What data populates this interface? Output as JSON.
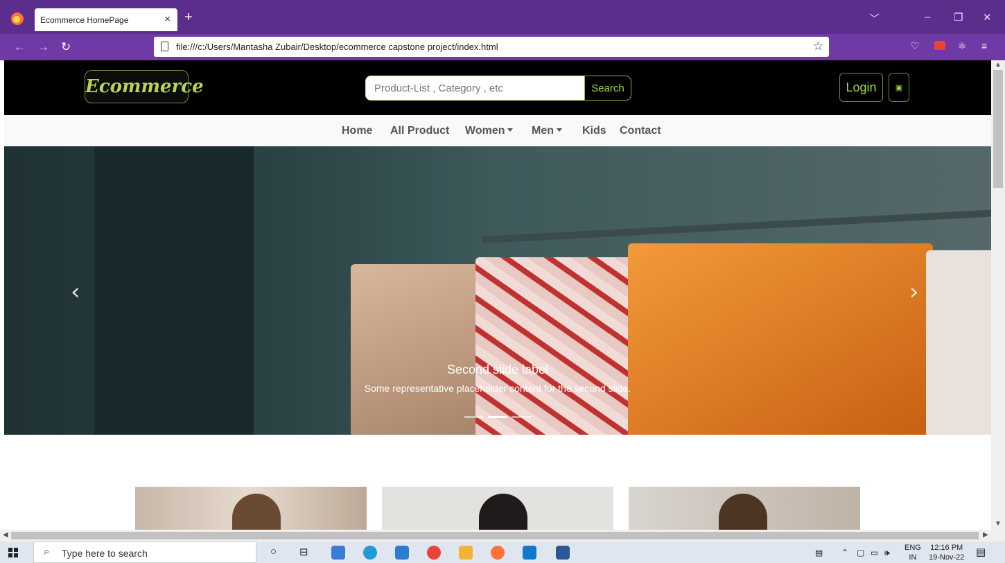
{
  "browser": {
    "tab_title": "Ecommerce HomePage",
    "tab_close": "×",
    "new_tab": "+",
    "url": "file:///c:/Users/Mantasha Zubair/Desktop/ecommerce capstone project/index.html",
    "win_controls": [
      "﹀",
      "–",
      "❐",
      "✕"
    ]
  },
  "site": {
    "brand": "Ecommerce",
    "search_placeholder": "Product-List , Category , etc",
    "search_button": "Search",
    "login_button": "Login",
    "nav": [
      "Home",
      "All Product",
      "Women",
      "Men",
      "Kids",
      "Contact"
    ],
    "carousel": {
      "caption_title": "Second slide label",
      "caption_text": "Some representative placeholder content for the second slide.",
      "prev": "‹",
      "next": "›",
      "slide_count": 3,
      "active_slide": 2
    }
  },
  "taskbar": {
    "search_placeholder": "Type here to search",
    "lang_top": "ENG",
    "lang_bottom": "IN",
    "time": "12:16 PM",
    "date": "19-Nov-22"
  },
  "colors": {
    "browser_tabbar": "#5b2d8c",
    "browser_toolbar": "#6f3aa6",
    "header_bg": "#000000",
    "accent_green": "#a7d63f"
  }
}
